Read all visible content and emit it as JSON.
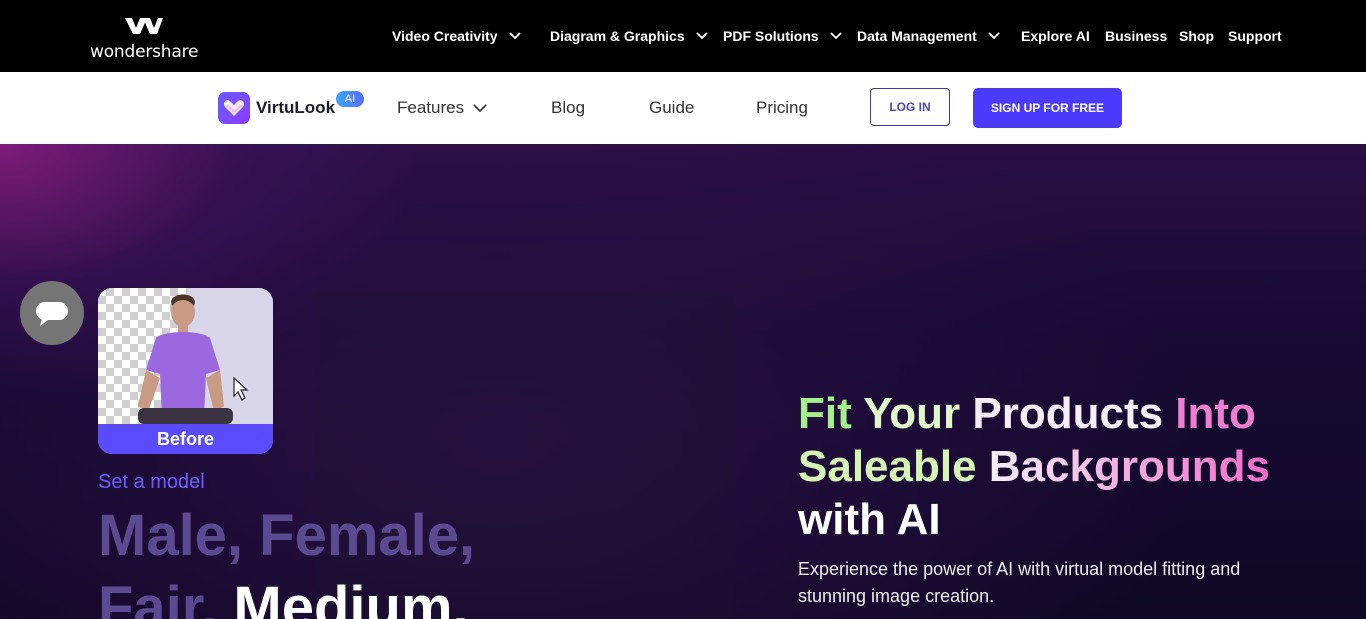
{
  "brand": {
    "logo_text": "wondershare",
    "accent": "#4b3bff"
  },
  "topnav": {
    "items": [
      {
        "label": "Video Creativity",
        "dropdown": true
      },
      {
        "label": "Diagram & Graphics",
        "dropdown": true
      },
      {
        "label": "PDF Solutions",
        "dropdown": true
      },
      {
        "label": "Data Management",
        "dropdown": true
      },
      {
        "label": "Explore AI",
        "dropdown": false
      },
      {
        "label": "Business",
        "dropdown": false
      },
      {
        "label": "Shop",
        "dropdown": false
      },
      {
        "label": "Support",
        "dropdown": false
      }
    ]
  },
  "subnav": {
    "product_name": "VirtuLook",
    "ai_badge": "AI",
    "links": [
      "Features",
      "Blog",
      "Guide",
      "Pricing"
    ],
    "login": "LOG IN",
    "signup": "SIGN UP FOR FREE"
  },
  "hero": {
    "before_label": "Before",
    "set_model": "Set a model",
    "line1": "Male, Female,",
    "line2_a": "Fair, ",
    "line2_b": "Medium,",
    "title_parts": {
      "fit": "Fit ",
      "your": "Your ",
      "products": "Products ",
      "into": "Into",
      "saleable": "Saleable ",
      "backgrounds": "Backgrounds",
      "with_ai": "with AI"
    },
    "subtitle": "Experience the power of AI with virtual model fitting and stunning image creation."
  },
  "icons": [
    "wondershare-logo-icon",
    "chevron-down-icon",
    "virtulook-logo-icon",
    "chat-icon",
    "cursor-icon"
  ]
}
